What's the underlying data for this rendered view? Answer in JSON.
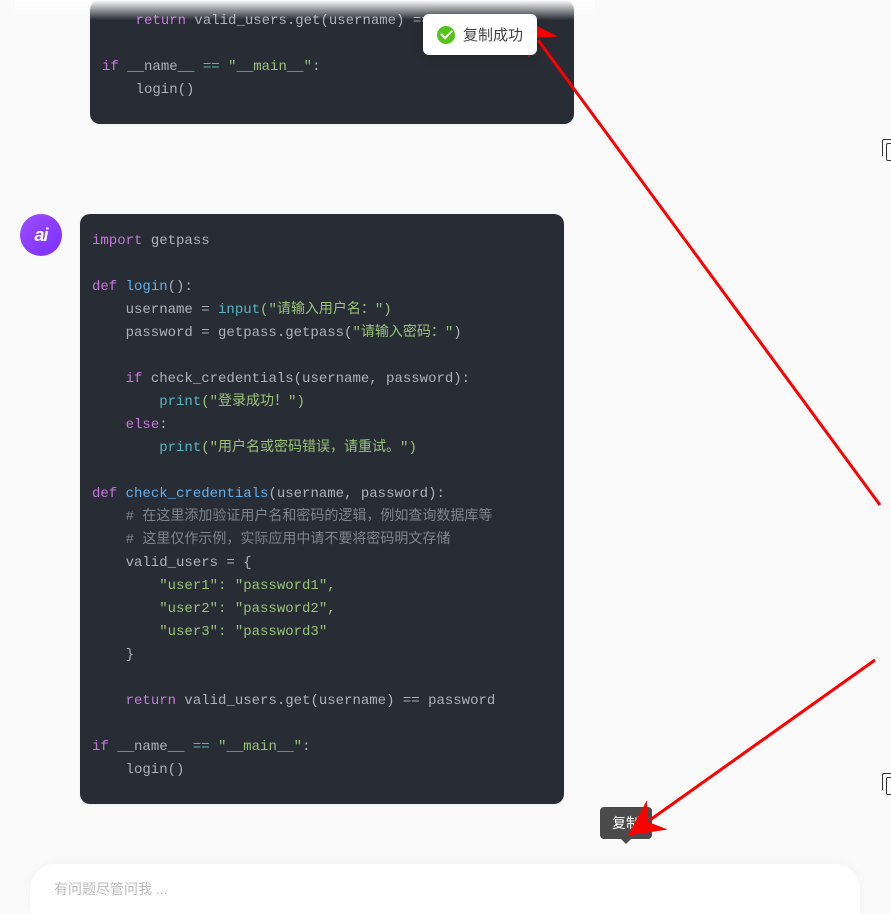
{
  "toast": {
    "text": "复制成功"
  },
  "tooltip": {
    "copy": "复制"
  },
  "avatar": {
    "label": "ai"
  },
  "input": {
    "placeholder": "有问题尽管问我 ..."
  },
  "code_top": {
    "ret_kw": "return",
    "ret_expr": " valid_users.get(username) == password",
    "if_kw": "if",
    "name_dunder": " __name__ ",
    "eq": "==",
    "main_str": " \"__main__\"",
    "colon": ":",
    "login_call": "    login()"
  },
  "code_main": {
    "import_kw": "import",
    "import_mod": " getpass",
    "def_kw": "def",
    "login_name": " login",
    "login_params": "():",
    "u_line_pre": "    username = ",
    "input_call": "input",
    "u_arg": "(\"请输入用户名：\")",
    "p_line_pre": "    password = getpass.getpass(",
    "p_arg": "\"请输入密码：\"",
    "p_close": ")",
    "if_kw": "if",
    "check_call": " check_credentials(username, password):",
    "print_call": "print",
    "succ_str": "(\"登录成功！\")",
    "else_kw": "else",
    "else_colon": ":",
    "fail_str": "(\"用户名或密码错误，请重试。\")",
    "check_def": " check_credentials",
    "check_params": "(username, password):",
    "cmt1": "    # 在这里添加验证用户名和密码的逻辑，例如查询数据库等",
    "cmt2": "    # 这里仅作示例，实际应用中请不要将密码明文存储",
    "vu_line": "    valid_users = {",
    "u1": "        \"user1\": \"password1\",",
    "u2": "        \"user2\": \"password2\",",
    "u3": "        \"user3\": \"password3\"",
    "close_brace": "    }",
    "ret_kw": "return",
    "ret_expr": " valid_users.get(username) == password",
    "name_dunder": " __name__ ",
    "eq": "==",
    "main_str": " \"__main__\"",
    "colon": ":",
    "login_call": "    login()"
  }
}
